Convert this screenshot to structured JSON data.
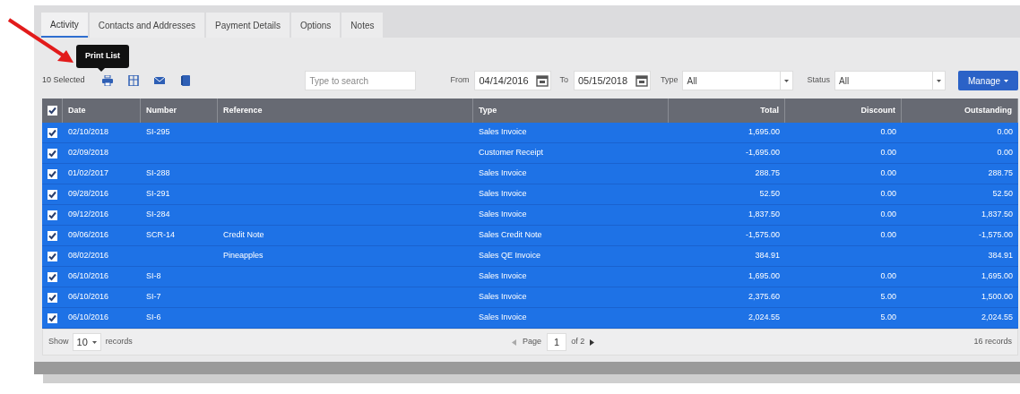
{
  "tabs": [
    {
      "label": "Activity",
      "selected": true
    },
    {
      "label": "Contacts and Addresses",
      "selected": false
    },
    {
      "label": "Payment Details",
      "selected": false
    },
    {
      "label": "Options",
      "selected": false
    },
    {
      "label": "Notes",
      "selected": false
    }
  ],
  "tooltip": "Print List",
  "toolbar": {
    "selected_count": "10 Selected",
    "search": {
      "placeholder": "Type to search"
    },
    "from_label": "From",
    "from": "04/14/2016",
    "to_label": "To",
    "to": "05/15/2018",
    "type_label": "Type",
    "type": "All",
    "status_label": "Status",
    "status": "All",
    "manage": "Manage"
  },
  "table": {
    "all_checked": true,
    "columns": [
      {
        "label": "Date"
      },
      {
        "label": "Number"
      },
      {
        "label": "Reference"
      },
      {
        "label": "Type"
      },
      {
        "label": "Total"
      },
      {
        "label": "Discount"
      },
      {
        "label": "Outstanding"
      }
    ],
    "rows": [
      {
        "selected": true,
        "checked": true,
        "cells": [
          "02/10/2018",
          "SI-295",
          "",
          "Sales Invoice",
          "1,695.00",
          "0.00",
          "0.00"
        ]
      },
      {
        "selected": true,
        "checked": true,
        "cells": [
          "02/09/2018",
          "",
          "",
          "Customer Receipt",
          "-1,695.00",
          "0.00",
          "0.00"
        ]
      },
      {
        "selected": true,
        "checked": true,
        "cells": [
          "01/02/2017",
          "SI-288",
          "",
          "Sales Invoice",
          "288.75",
          "0.00",
          "288.75"
        ]
      },
      {
        "selected": true,
        "checked": true,
        "cells": [
          "09/28/2016",
          "SI-291",
          "",
          "Sales Invoice",
          "52.50",
          "0.00",
          "52.50"
        ]
      },
      {
        "selected": true,
        "checked": true,
        "cells": [
          "09/12/2016",
          "SI-284",
          "",
          "Sales Invoice",
          "1,837.50",
          "0.00",
          "1,837.50"
        ]
      },
      {
        "selected": true,
        "checked": true,
        "cells": [
          "09/06/2016",
          "SCR-14",
          "Credit Note",
          "Sales Credit Note",
          "-1,575.00",
          "0.00",
          "-1,575.00"
        ]
      },
      {
        "selected": true,
        "checked": true,
        "cells": [
          "08/02/2016",
          "",
          "Pineapples",
          "Sales QE Invoice",
          "384.91",
          "",
          "384.91"
        ]
      },
      {
        "selected": true,
        "checked": true,
        "cells": [
          "06/10/2016",
          "SI-8",
          "",
          "Sales Invoice",
          "1,695.00",
          "0.00",
          "1,695.00"
        ]
      },
      {
        "selected": true,
        "checked": true,
        "cells": [
          "06/10/2016",
          "SI-7",
          "",
          "Sales Invoice",
          "2,375.60",
          "5.00",
          "1,500.00"
        ]
      },
      {
        "selected": true,
        "checked": true,
        "cells": [
          "06/10/2016",
          "SI-6",
          "",
          "Sales Invoice",
          "2,024.55",
          "5.00",
          "2,024.55"
        ]
      }
    ]
  },
  "footer": {
    "show": "Show",
    "page_size": "10",
    "records_label": "records",
    "page_label": "Page",
    "page": "1",
    "of": "of 2",
    "total": "16 records"
  }
}
